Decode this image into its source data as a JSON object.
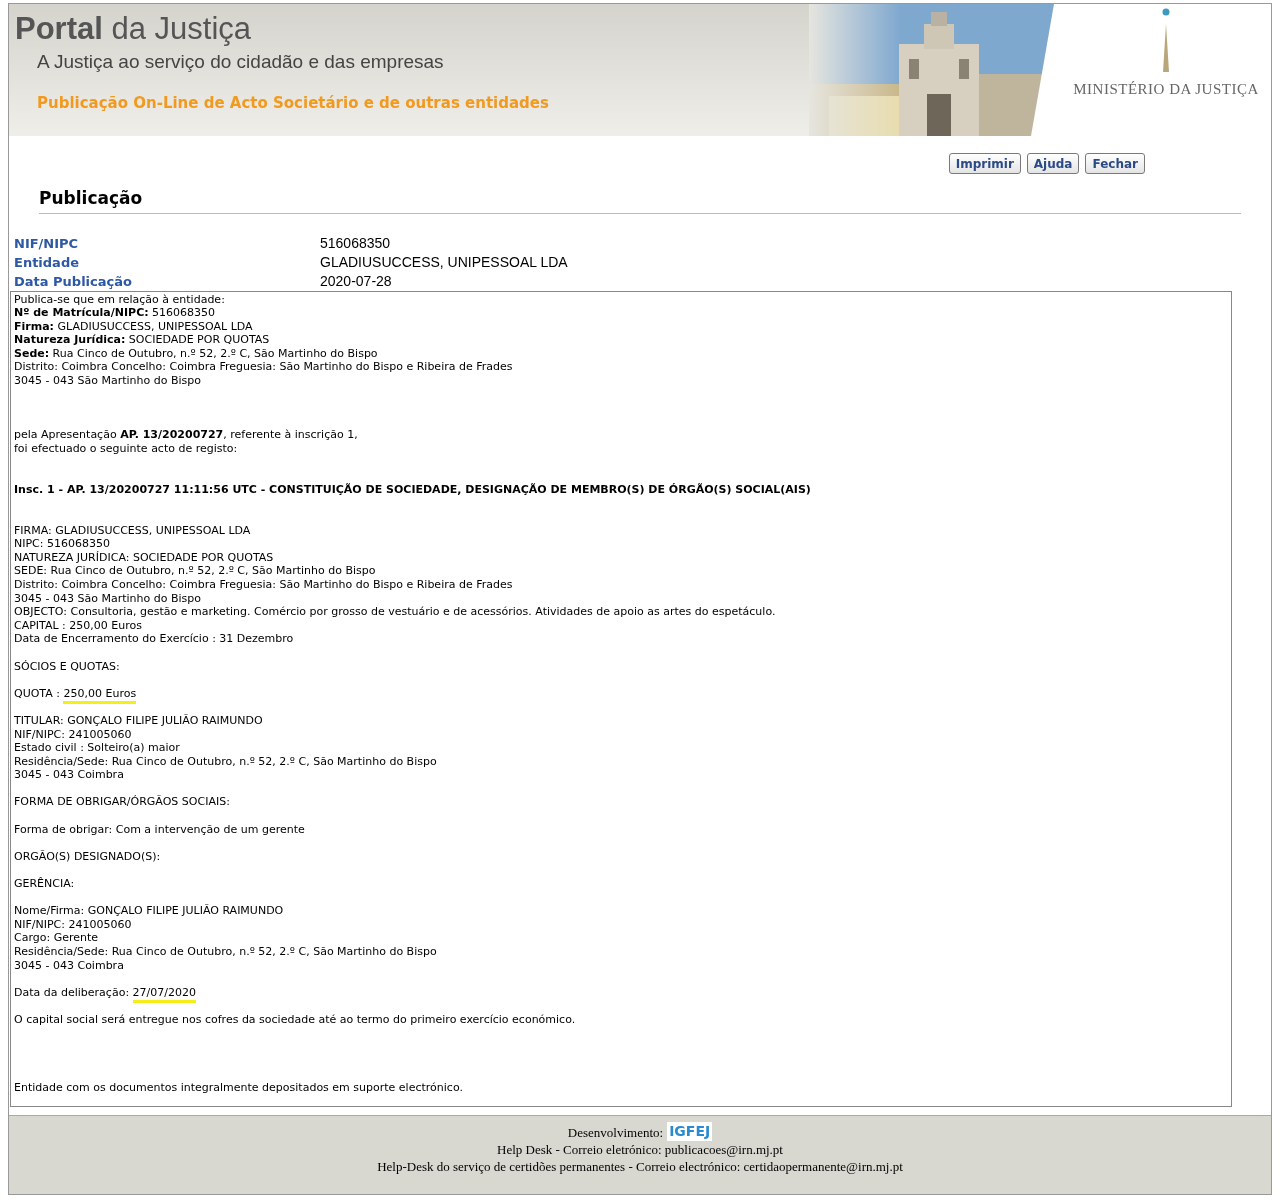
{
  "header": {
    "title": "**Portal** da Justiça",
    "subtitle": "A Justiça ao serviço do cidadão e das empresas",
    "tagline": "Publicação On-Line de Acto Societário e de outras entidades",
    "ministry": "MINISTÉRIO DA JUSTIÇA"
  },
  "buttons": [
    "Imprimir",
    "Ajuda",
    "Fechar"
  ],
  "section_title": "Publicação",
  "fields": [
    {
      "label": "NIF/NIPC",
      "value": "516068350"
    },
    {
      "label": "Entidade",
      "value": "GLADIUSUCCESS, UNIPESSOAL LDA"
    },
    {
      "label": "Data Publicação",
      "value": "2020-07-28"
    }
  ],
  "lines": [
    {
      "kind": "text",
      "text": "Publica-se que em relação à entidade:"
    },
    {
      "kind": "text",
      "text": "**Nº de Matrícula/NIPC:** 516068350"
    },
    {
      "kind": "text",
      "text": "**Firma:** GLADIUSUCCESS, UNIPESSOAL LDA"
    },
    {
      "kind": "text",
      "text": "**Natureza Jurídica:** SOCIEDADE POR QUOTAS"
    },
    {
      "kind": "text",
      "text": "**Sede:** Rua Cinco de Outubro, n.º 52, 2.º C, São Martinho do Bispo"
    },
    {
      "kind": "text",
      "text": "Distrito: Coimbra Concelho: Coimbra Freguesia: São Martinho do Bispo e Ribeira de Frades"
    },
    {
      "kind": "text",
      "text": "3045 - 043 São Martinho do Bispo"
    },
    {
      "kind": "break"
    },
    {
      "kind": "break"
    },
    {
      "kind": "break"
    },
    {
      "kind": "text",
      "text": "pela Apresentação **AP. 13/20200727**, referente à inscrição 1,"
    },
    {
      "kind": "text",
      "text": "foi efectuado o seguinte acto de registo:"
    },
    {
      "kind": "break"
    },
    {
      "kind": "break"
    },
    {
      "kind": "heading",
      "text": "Insc. 1 - AP. 13/20200727 11:11:56 UTC - CONSTITUIÇÃO DE SOCIEDADE, DESIGNAÇÃO DE MEMBRO(S) DE ÓRGÃO(S) SOCIAL(AIS)"
    },
    {
      "kind": "break"
    },
    {
      "kind": "break"
    },
    {
      "kind": "text",
      "text": "FIRMA: GLADIUSUCCESS, UNIPESSOAL LDA"
    },
    {
      "kind": "text",
      "text": "NIPC: 516068350"
    },
    {
      "kind": "text",
      "text": "NATUREZA JURÍDICA: SOCIEDADE POR QUOTAS"
    },
    {
      "kind": "text",
      "text": "SEDE: Rua Cinco de Outubro, n.º 52, 2.º C, São Martinho do Bispo"
    },
    {
      "kind": "text",
      "text": "Distrito: Coimbra Concelho: Coimbra Freguesia: São Martinho do Bispo e Ribeira de Frades"
    },
    {
      "kind": "text",
      "text": "3045 - 043 São Martinho do Bispo"
    },
    {
      "kind": "text",
      "text": "OBJECTO: Consultoria, gestão e marketing. Comércio por grosso de vestuário e de acessórios. Atividades de apoio as artes do espetáculo."
    },
    {
      "kind": "text",
      "text": "CAPITAL : 250,00 Euros"
    },
    {
      "kind": "text",
      "text": "Data de Encerramento do Exercício : 31 Dezembro"
    },
    {
      "kind": "break"
    },
    {
      "kind": "text",
      "text": "SÓCIOS E QUOTAS:"
    },
    {
      "kind": "break"
    },
    {
      "kind": "marked",
      "text": "QUOTA : ",
      "mark": "250,00 Euros"
    },
    {
      "kind": "break"
    },
    {
      "kind": "text",
      "text": "TITULAR: GONÇALO FILIPE JULIÃO RAIMUNDO"
    },
    {
      "kind": "text",
      "text": "NIF/NIPC: 241005060"
    },
    {
      "kind": "text",
      "text": "Estado civil : Solteiro(a) maior"
    },
    {
      "kind": "text",
      "text": "Residência/Sede: Rua Cinco de Outubro, n.º 52, 2.º C, São Martinho do Bispo"
    },
    {
      "kind": "text",
      "text": "3045 - 043 Coimbra"
    },
    {
      "kind": "break"
    },
    {
      "kind": "text",
      "text": "FORMA DE OBRIGAR/ÓRGÃOS SOCIAIS:"
    },
    {
      "kind": "break"
    },
    {
      "kind": "text",
      "text": "Forma de obrigar: Com a intervenção de um gerente"
    },
    {
      "kind": "break"
    },
    {
      "kind": "text",
      "text": "ORGÃO(S) DESIGNADO(S):"
    },
    {
      "kind": "break"
    },
    {
      "kind": "text",
      "text": "GERÊNCIA:"
    },
    {
      "kind": "break"
    },
    {
      "kind": "text",
      "text": "Nome/Firma: GONÇALO FILIPE JULIÃO RAIMUNDO"
    },
    {
      "kind": "text",
      "text": "NIF/NIPC: 241005060"
    },
    {
      "kind": "text",
      "text": "Cargo: Gerente"
    },
    {
      "kind": "text",
      "text": "Residência/Sede: Rua Cinco de Outubro, n.º 52, 2.º C, São Martinho do Bispo"
    },
    {
      "kind": "text",
      "text": "3045 - 043 Coimbra"
    },
    {
      "kind": "break"
    },
    {
      "kind": "marked",
      "text": "Data da deliberação: ",
      "mark": "27/07/2020"
    },
    {
      "kind": "break"
    },
    {
      "kind": "text",
      "text": "O capital social será entregue nos cofres da sociedade até ao termo do primeiro exercício económico."
    },
    {
      "kind": "break"
    },
    {
      "kind": "break"
    },
    {
      "kind": "break"
    },
    {
      "kind": "break"
    },
    {
      "kind": "text",
      "text": "Entidade com os documentos integralmente depositados em suporte electrónico."
    }
  ],
  "footer": {
    "dev_label": "Desenvolvimento:",
    "dev_logo": "IGFEJ",
    "lines": [
      "Help Desk - Correio eletrónico: publicacoes@irn.mj.pt",
      "Help-Desk do serviço de certidões permanentes - Correio electrónico: certidaopermanente@irn.mj.pt"
    ]
  }
}
